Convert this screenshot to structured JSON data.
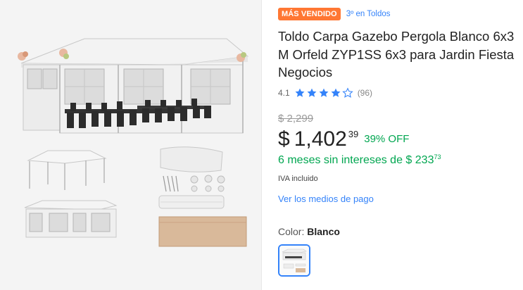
{
  "product": {
    "badge": "MÁS VENDIDO",
    "rank": "3º en Toldos",
    "title": "Toldo Carpa Gazebo Pergola Blanco 6x3 M Orfeld ZYP1SS 6x3 para Jardin Fiesta Negocios",
    "rating": "4.1",
    "rating_value": 4.1,
    "reviews": "(96)",
    "old_price": "$ 2,299",
    "price": {
      "currency": "$",
      "integer": "1,402",
      "cents": "39"
    },
    "discount": "39% OFF",
    "installments": {
      "text": "6 meses sin intereses de $ 233",
      "cents": "73"
    },
    "tax": "IVA incluido",
    "payment_link": "Ver los medios de pago",
    "color": {
      "label": "Color: ",
      "value": "Blanco"
    }
  },
  "colors": {
    "badge": "#ff7733",
    "link": "#3483fa",
    "green": "#00a650",
    "star": "#3483fa"
  },
  "icons": {
    "star_full": "star-icon",
    "star_empty": "star-outline-icon"
  }
}
